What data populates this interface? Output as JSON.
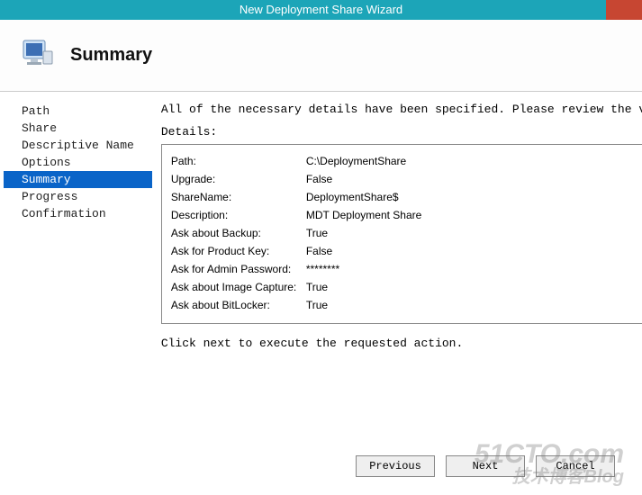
{
  "window": {
    "title": "New Deployment Share Wizard"
  },
  "header": {
    "title": "Summary"
  },
  "sidebar": {
    "steps": [
      {
        "label": "Path",
        "selected": false
      },
      {
        "label": "Share",
        "selected": false
      },
      {
        "label": "Descriptive Name",
        "selected": false
      },
      {
        "label": "Options",
        "selected": false
      },
      {
        "label": "Summary",
        "selected": true
      },
      {
        "label": "Progress",
        "selected": false
      },
      {
        "label": "Confirmation",
        "selected": false
      }
    ]
  },
  "main": {
    "intro": "All of the necessary details have been specified.  Please review the values below.",
    "details_label": "Details:",
    "details": [
      {
        "key": "Path:",
        "value": "C:\\DeploymentShare"
      },
      {
        "key": "Upgrade:",
        "value": "False"
      },
      {
        "key": "ShareName:",
        "value": "DeploymentShare$"
      },
      {
        "key": "Description:",
        "value": "MDT Deployment Share"
      },
      {
        "key": "Ask about Backup:",
        "value": "True"
      },
      {
        "key": "Ask for Product Key:",
        "value": "False"
      },
      {
        "key": "Ask for Admin Password:",
        "value": "********"
      },
      {
        "key": "Ask about Image Capture:",
        "value": "True"
      },
      {
        "key": "Ask about BitLocker:",
        "value": "True"
      }
    ],
    "footer": "Click next to execute the requested action."
  },
  "buttons": {
    "previous": "Previous",
    "next": "Next",
    "cancel": "Cancel"
  },
  "watermark": {
    "line1": "51CTO.com",
    "line2": "技术博客Blog"
  }
}
